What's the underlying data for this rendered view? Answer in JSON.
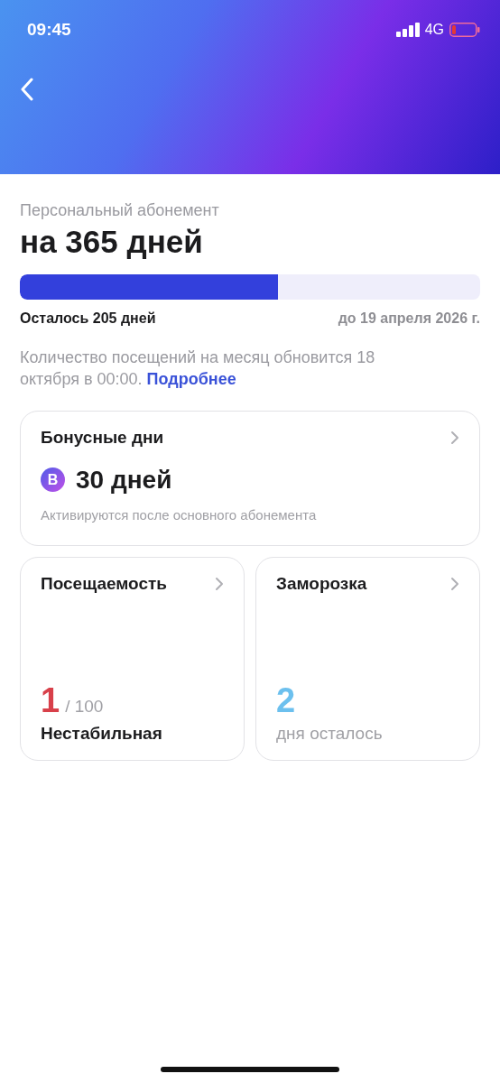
{
  "status_bar": {
    "time": "09:45",
    "network": "4G"
  },
  "subscription": {
    "subtitle": "Персональный абонемент",
    "title": "на 365 дней",
    "level": 0.56,
    "remaining": "Осталось 205 дней",
    "until": "до 19 апреля 2026 г."
  },
  "notice": {
    "text": "Количество посещений на месяц обновится 18 октября в 00:00.",
    "link": "Подробнее"
  },
  "bonus_card": {
    "title": "Бонусные дни",
    "badge": "B",
    "value": "30 дней",
    "note": "Активируются после основного абонемента"
  },
  "small_cards": [
    {
      "title": "Посещаемость",
      "value": "1",
      "total": "/ 100",
      "caption": "Нестабильная",
      "color": "#d8404a",
      "kind": "attendance"
    },
    {
      "title": "Заморозка",
      "value": "2",
      "caption": "дня осталось",
      "color": "#6cc0ee",
      "kind": "freeze"
    }
  ]
}
